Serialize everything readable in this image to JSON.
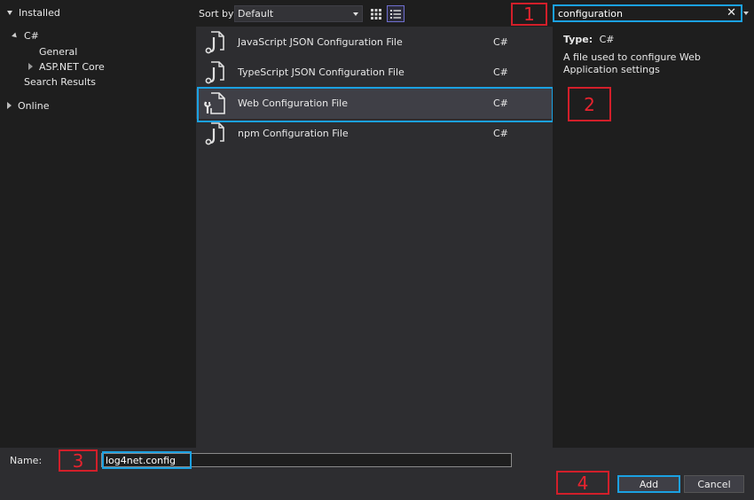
{
  "tree": {
    "installed": "Installed",
    "csharp": "C#",
    "general": "General",
    "aspnet": "ASP.NET Core",
    "search_results": "Search Results",
    "online": "Online"
  },
  "toolbar": {
    "sort_label": "Sort by:",
    "sort_value": "Default",
    "grid_view_icon": "grid-view-icon",
    "list_view_icon": "list-view-icon"
  },
  "search": {
    "value": "configuration",
    "clear": "✕"
  },
  "templates": [
    {
      "name": "JavaScript JSON Configuration File",
      "lang": "C#",
      "icon": "json-file-icon"
    },
    {
      "name": "TypeScript JSON Configuration File",
      "lang": "C#",
      "icon": "json-file-icon"
    },
    {
      "name": "Web Configuration File",
      "lang": "C#",
      "icon": "config-file-icon"
    },
    {
      "name": "npm Configuration File",
      "lang": "C#",
      "icon": "json-file-icon"
    }
  ],
  "details": {
    "type_label": "Type:",
    "type_value": "C#",
    "description": "A file used to configure Web Application settings"
  },
  "bottom": {
    "name_label": "Name:",
    "name_value": "log4net.config",
    "add": "Add",
    "cancel": "Cancel"
  },
  "callouts": [
    "1",
    "2",
    "3",
    "4"
  ],
  "colors": {
    "callout_red": "#d21f2a",
    "highlight_blue": "#1ba1e2",
    "selected_row": "#3f3f46"
  }
}
